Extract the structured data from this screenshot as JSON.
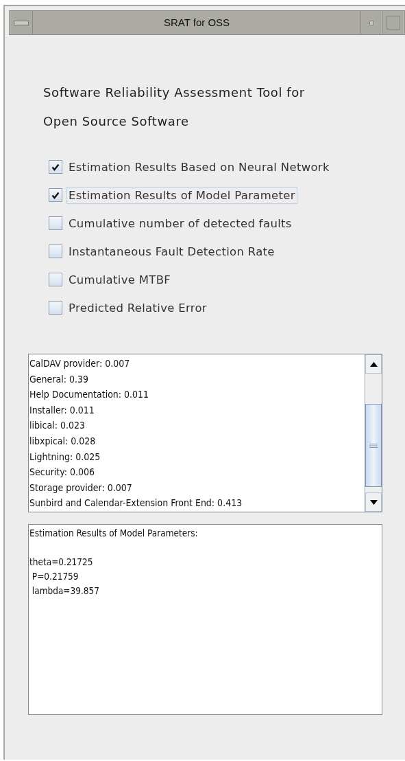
{
  "window": {
    "title": "SRAT for OSS"
  },
  "heading": [
    "Software Reliability Assessment Tool for",
    "Open Source Software"
  ],
  "options": [
    {
      "label": "Estimation Results Based on Neural Network",
      "checked": true,
      "focused": false
    },
    {
      "label": "Estimation Results of Model Parameter",
      "checked": true,
      "focused": true
    },
    {
      "label": "Cumulative number of detected faults",
      "checked": false,
      "focused": false
    },
    {
      "label": "Instantaneous Fault Detection Rate",
      "checked": false,
      "focused": false
    },
    {
      "label": "Cumulative MTBF",
      "checked": false,
      "focused": false
    },
    {
      "label": "Predicted Relative Error",
      "checked": false,
      "focused": false
    }
  ],
  "results_list": {
    "items": [
      "CalDAV provider: 0.007",
      "General: 0.39",
      "Help Documentation: 0.011",
      "Installer: 0.011",
      "libical: 0.023",
      "libxpical: 0.028",
      "Lightning: 0.025",
      "Security: 0.006",
      "Storage provider: 0.007",
      "Sunbird and Calendar-Extension Front End: 0.413"
    ]
  },
  "output": {
    "title": "Estimation Results of Model Parameters:",
    "lines": [
      "theta=0.21725",
      " P=0.21759",
      " lambda=39.857"
    ]
  }
}
